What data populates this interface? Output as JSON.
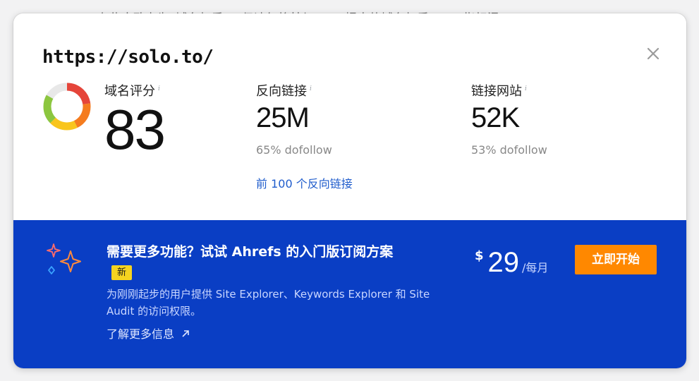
{
  "background": {
    "partial_text": "有些人致力为“域名权重”，但请勿将基与 Moz 提出的域名权重 (DA) 指标混"
  },
  "overview": {
    "domain": "https://solo.to/",
    "domain_rating": {
      "label": "域名评分",
      "info_icon": "i",
      "value": "83",
      "gauge_fraction": 0.83,
      "gauge_colors": [
        "#e8e8e8",
        "#e5453a",
        "#f57c1f",
        "#f9c51d",
        "#8cc63f"
      ]
    },
    "backlinks": {
      "label": "反向链接",
      "info_icon": "i",
      "value": "25M",
      "sub": "65% dofollow",
      "link": "前 100 个反向链接"
    },
    "referring_domains": {
      "label": "链接网站",
      "info_icon": "i",
      "value": "52K",
      "sub": "53% dofollow"
    },
    "close_icon": "close-icon"
  },
  "promo": {
    "title": "需要更多功能？试试 Ahrefs 的入门版订阅方案",
    "badge": "新",
    "description": "为刚刚起步的用户提供 Site Explorer、Keywords Explorer 和 Site Audit 的访问权限。",
    "learn_more": "了解更多信息",
    "learn_more_icon": "arrow-up-right-icon",
    "price": {
      "currency": "$",
      "amount": "29",
      "period": "/每月"
    },
    "cta": "立即开始",
    "colors": {
      "background": "#0a3ec4",
      "cta": "#ff8800",
      "badge": "#f5d320"
    }
  }
}
